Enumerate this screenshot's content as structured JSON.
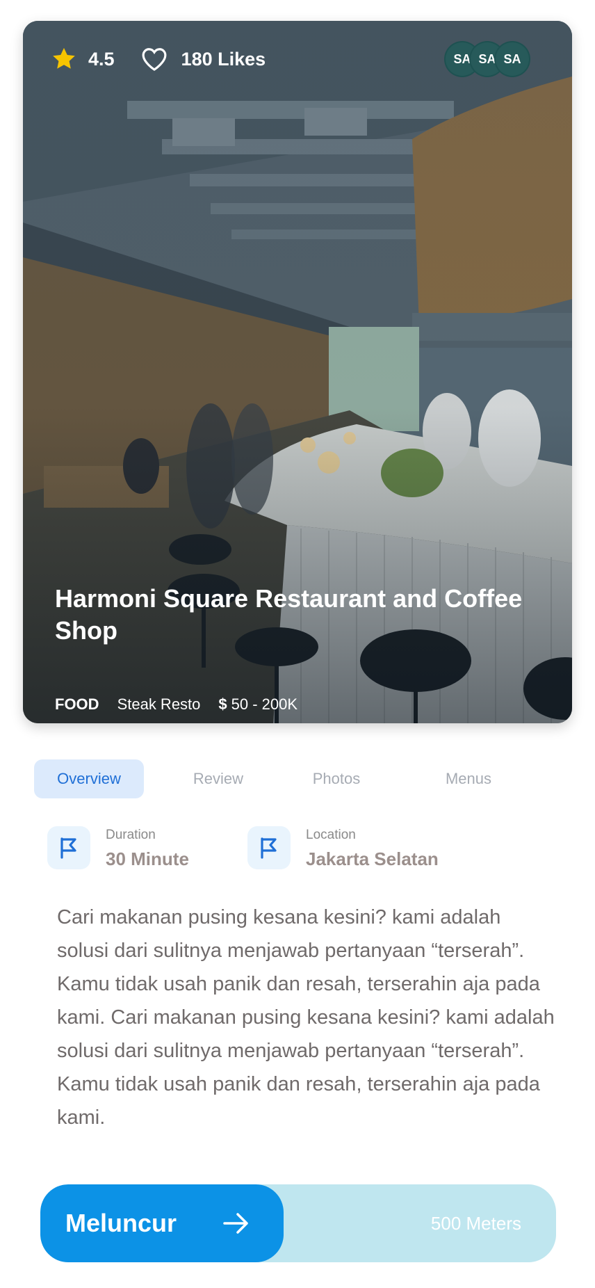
{
  "hero": {
    "rating": "4.5",
    "likes": "180 Likes",
    "avatars": [
      "SA",
      "SA",
      "SA"
    ],
    "title": "Harmoni Square Restaurant and Coffee Shop",
    "category": "FOOD",
    "subcategory": "Steak Resto",
    "price_symbol": "$",
    "price_range": "50 - 200K"
  },
  "tabs": [
    {
      "label": "Overview",
      "active": true
    },
    {
      "label": "Review",
      "active": false
    },
    {
      "label": "Photos",
      "active": false
    },
    {
      "label": "Menus",
      "active": false
    }
  ],
  "info": {
    "duration_label": "Duration",
    "duration_value": "30 Minute",
    "location_label": "Location",
    "location_value": "Jakarta Selatan"
  },
  "description": "Cari makanan pusing kesana kesini? kami adalah solusi dari sulitnya menjawab pertanyaan “terserah”. Kamu tidak usah panik dan resah, terserahin aja pada kami. Cari makanan pusing kesana kesini? kami adalah solusi dari sulitnya menjawab pertanyaan “terserah”. Kamu tidak usah panik dan resah, terserahin aja pada kami.",
  "action": {
    "button_label": "Meluncur",
    "distance": "500 Meters"
  },
  "colors": {
    "accent": "#0c92e6",
    "tab_active_bg": "#dceafc",
    "tab_active_text": "#1f6fd6",
    "star": "#f7c400",
    "slider_track": "#bfe6ef"
  },
  "icons": {
    "rating": "star-icon",
    "likes": "heart-icon",
    "duration": "flag-icon",
    "location": "flag-icon",
    "action": "arrow-right-icon"
  }
}
